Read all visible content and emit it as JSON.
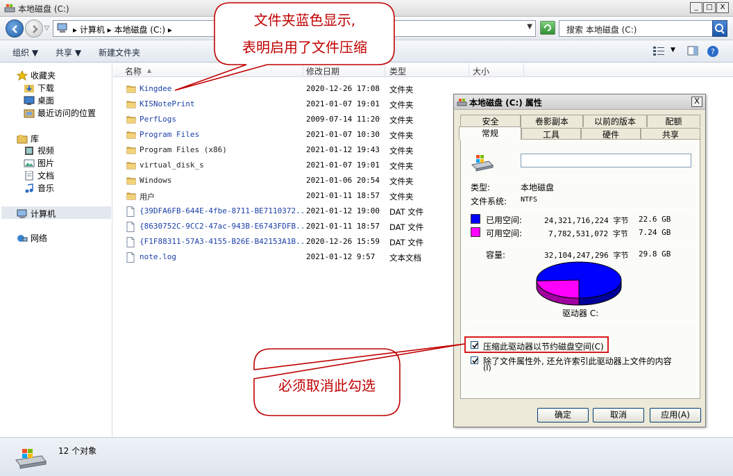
{
  "window": {
    "title": "本地磁盘 (C:)",
    "buttons": [
      "_",
      "□",
      "X"
    ]
  },
  "address": {
    "crumbs": "▸ 计算机 ▸ 本地磁盘 (C:) ▸",
    "search_placeholder": "搜索 本地磁盘 (C:)"
  },
  "toolbar": {
    "organize": "组织 ▼",
    "share": "共享 ▼",
    "new_folder": "新建文件夹"
  },
  "sidebar": {
    "favorites": "收藏夹",
    "downloads": "下载",
    "desktop": "桌面",
    "recent": "最近访问的位置",
    "libraries": "库",
    "videos": "视频",
    "pictures": "图片",
    "documents": "文档",
    "music": "音乐",
    "computer": "计算机",
    "network": "网络"
  },
  "columns": {
    "name": "名称",
    "modified": "修改日期",
    "type": "类型",
    "size": "大小"
  },
  "files": [
    {
      "name": "Kingdee",
      "date": "2020-12-26 17:08",
      "type": "文件夹",
      "kind": "folder",
      "compressed": true
    },
    {
      "name": "KISNotePrint",
      "date": "2021-01-07 19:01",
      "type": "文件夹",
      "kind": "folder",
      "compressed": true
    },
    {
      "name": "PerfLogs",
      "date": "2009-07-14 11:20",
      "type": "文件夹",
      "kind": "folder",
      "compressed": true
    },
    {
      "name": "Program Files",
      "date": "2021-01-07 10:30",
      "type": "文件夹",
      "kind": "folder",
      "compressed": true
    },
    {
      "name": "Program Files (x86)",
      "date": "2021-01-12 19:43",
      "type": "文件夹",
      "kind": "folder",
      "compressed": false
    },
    {
      "name": "virtual_disk_s",
      "date": "2021-01-07 19:01",
      "type": "文件夹",
      "kind": "folder",
      "compressed": false
    },
    {
      "name": "Windows",
      "date": "2021-01-06 20:54",
      "type": "文件夹",
      "kind": "folder",
      "compressed": false
    },
    {
      "name": "用户",
      "date": "2021-01-11 18:57",
      "type": "文件夹",
      "kind": "folder",
      "compressed": false
    },
    {
      "name": "{39DFA6FB-644E-4fbe-8711-BE7110372...",
      "date": "2021-01-12 19:00",
      "type": "DAT 文件",
      "kind": "file",
      "compressed": true
    },
    {
      "name": "{8630752C-9CC2-47ac-943B-E6743FDFB...",
      "date": "2021-01-11 18:57",
      "type": "DAT 文件",
      "kind": "file",
      "compressed": true
    },
    {
      "name": "{F1F88311-57A3-4155-B26E-B42153A1B...",
      "date": "2020-12-26 15:59",
      "type": "DAT 文件",
      "kind": "file",
      "compressed": true
    },
    {
      "name": "note.log",
      "date": "2021-01-12 9:57",
      "type": "文本文档",
      "kind": "file",
      "compressed": true
    }
  ],
  "status": {
    "count": "12 个对象"
  },
  "dialog": {
    "title": "本地磁盘 (C:) 属性",
    "close": "X",
    "tabs_top": [
      "安全",
      "卷影副本",
      "以前的版本",
      "配额"
    ],
    "tabs_bottom": [
      "常规",
      "工具",
      "硬件",
      "共享"
    ],
    "type_label": "类型:",
    "type_value": "本地磁盘",
    "fs_label": "文件系统:",
    "fs_value": "NTFS",
    "used_label": "已用空间:",
    "used_bytes": "24,321,716,224 字节",
    "used_gb": "22.6 GB",
    "free_label": "可用空间:",
    "free_bytes": "7,782,531,072 字节",
    "free_gb": "7.24 GB",
    "capacity_label": "容量:",
    "capacity_bytes": "32,104,247,296 字节",
    "capacity_gb": "29.8 GB",
    "drive_label": "驱动器 C:",
    "compress_label": "压缩此驱动器以节约磁盘空间(C)",
    "index_label": "除了文件属性外, 还允许索引此驱动器上文件的内容",
    "index_label2": "(I)",
    "compress_checked": true,
    "index_checked": true,
    "used_fraction": 0.7576,
    "used_color": "#0000ff",
    "free_color": "#ff00ff",
    "ok": "确定",
    "cancel": "取消",
    "apply": "应用(A)"
  },
  "callouts": {
    "top_line1": "文件夹蓝色显示,",
    "top_line2": "表明启用了文件压缩",
    "bottom": "必须取消此勾选"
  },
  "colors": {
    "compressed_text": "#1a3fa8",
    "callout_red": "#c00000"
  }
}
